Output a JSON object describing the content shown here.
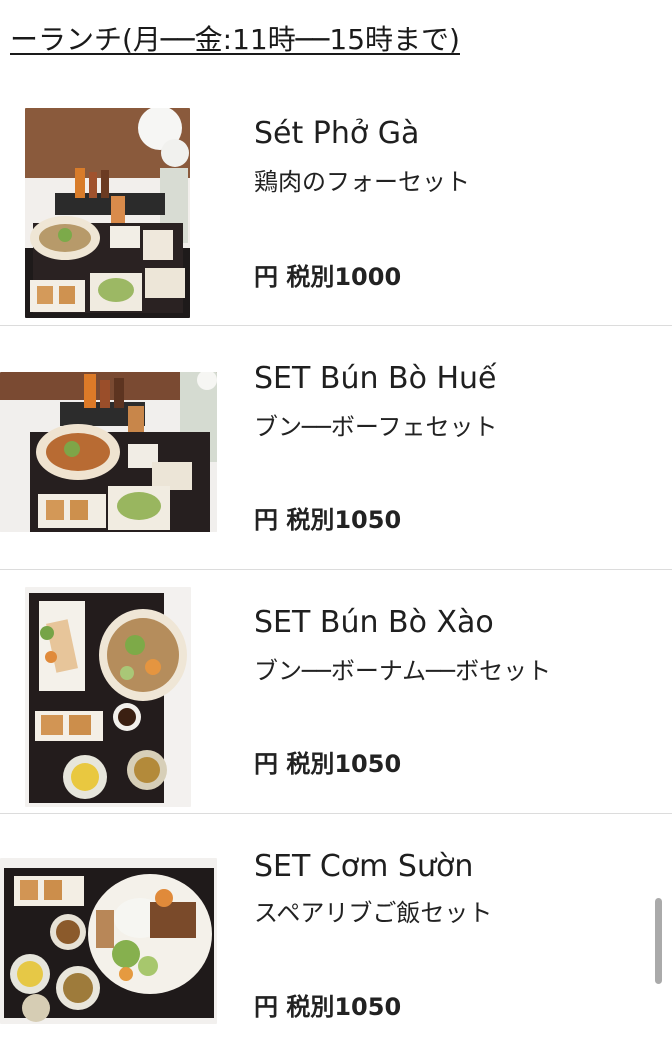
{
  "header": {
    "title": "ーランチ(月──金:11時──15時まで)"
  },
  "menu": {
    "items": [
      {
        "name": "Sét Phở Gà",
        "subtitle": "鶏肉のフォーセット",
        "price": "円 税別1000"
      },
      {
        "name": "SET Bún Bò Huế",
        "subtitle": "ブン──ボーフェセット",
        "price": "円 税別1050"
      },
      {
        "name": "SET Bún Bò Xào",
        "subtitle": "ブン──ボーナム──ボセット",
        "price": "円 税別1050"
      },
      {
        "name": "SET Cơm Sườn",
        "subtitle": "スペアリブご飯セット",
        "price": "円 税別1050"
      }
    ]
  }
}
